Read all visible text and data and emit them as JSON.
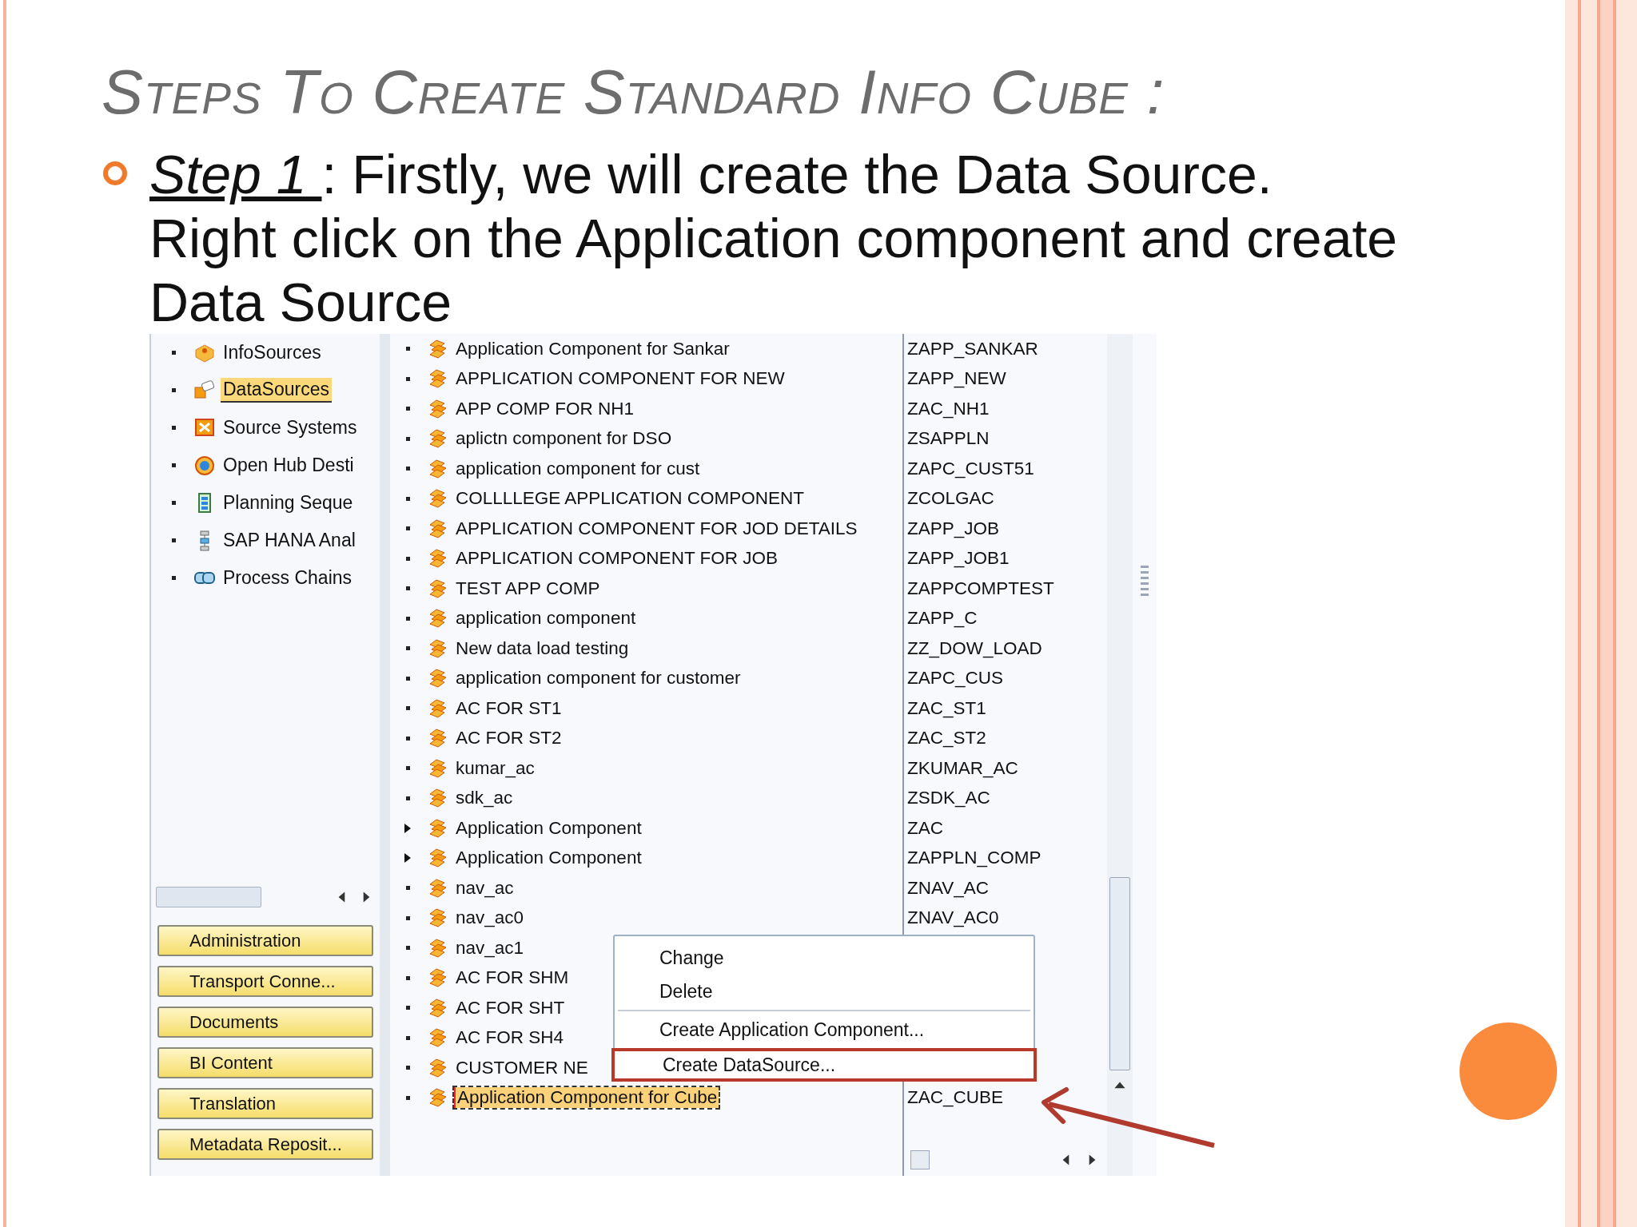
{
  "slide": {
    "title": "Steps To Create Standard Info Cube :",
    "step_label": "Step 1 ",
    "step_text": ": Firstly, we will create the Data Source. Right click on the Application component and create Data Source"
  },
  "sap": {
    "nav_tree": [
      {
        "label": "InfoSources",
        "selected": false
      },
      {
        "label": "DataSources",
        "selected": true
      },
      {
        "label": "Source Systems",
        "selected": false
      },
      {
        "label": "Open Hub Desti",
        "selected": false
      },
      {
        "label": "Planning Seque",
        "selected": false
      },
      {
        "label": "SAP HANA Anal",
        "selected": false
      },
      {
        "label": "Process Chains",
        "selected": false
      }
    ],
    "nav_buttons": [
      "Administration",
      "Transport Conne...",
      "Documents",
      "BI Content",
      "Translation",
      "Metadata Reposit..."
    ],
    "components": [
      {
        "name": "Application Component for Sankar",
        "tech_name": "ZAPP_SANKAR",
        "has_children": false,
        "selected": false
      },
      {
        "name": "APPLICATION COMPONENT FOR NEW",
        "tech_name": "ZAPP_NEW",
        "has_children": false,
        "selected": false
      },
      {
        "name": "APP COMP FOR NH1",
        "tech_name": "ZAC_NH1",
        "has_children": false,
        "selected": false
      },
      {
        "name": "aplictn component for DSO",
        "tech_name": "ZSAPPLN",
        "has_children": false,
        "selected": false
      },
      {
        "name": "application component for cust",
        "tech_name": "ZAPC_CUST51",
        "has_children": false,
        "selected": false
      },
      {
        "name": "COLLLLEGE APPLICATION COMPONENT",
        "tech_name": "ZCOLGAC",
        "has_children": false,
        "selected": false
      },
      {
        "name": "APPLICATION COMPONENT FOR JOD DETAILS",
        "tech_name": "ZAPP_JOB",
        "has_children": false,
        "selected": false
      },
      {
        "name": "APPLICATION COMPONENT FOR JOB",
        "tech_name": "ZAPP_JOB1",
        "has_children": false,
        "selected": false
      },
      {
        "name": "TEST APP COMP",
        "tech_name": "ZAPPCOMPTEST",
        "has_children": false,
        "selected": false
      },
      {
        "name": "application component",
        "tech_name": "ZAPP_C",
        "has_children": false,
        "selected": false
      },
      {
        "name": "New data load testing",
        "tech_name": "ZZ_DOW_LOAD",
        "has_children": false,
        "selected": false
      },
      {
        "name": "application component for customer",
        "tech_name": "ZAPC_CUS",
        "has_children": false,
        "selected": false
      },
      {
        "name": "AC FOR ST1",
        "tech_name": "ZAC_ST1",
        "has_children": false,
        "selected": false
      },
      {
        "name": "AC FOR ST2",
        "tech_name": "ZAC_ST2",
        "has_children": false,
        "selected": false
      },
      {
        "name": "kumar_ac",
        "tech_name": "ZKUMAR_AC",
        "has_children": false,
        "selected": false
      },
      {
        "name": "sdk_ac",
        "tech_name": "ZSDK_AC",
        "has_children": false,
        "selected": false
      },
      {
        "name": "Application Component",
        "tech_name": "ZAC",
        "has_children": true,
        "selected": false
      },
      {
        "name": "Application Component",
        "tech_name": "ZAPPLN_COMP",
        "has_children": true,
        "selected": false
      },
      {
        "name": "nav_ac",
        "tech_name": "ZNAV_AC",
        "has_children": false,
        "selected": false
      },
      {
        "name": "nav_ac0",
        "tech_name": "ZNAV_AC0",
        "has_children": false,
        "selected": false
      },
      {
        "name": "nav_ac1",
        "has_children": false,
        "selected": false
      },
      {
        "name": "AC FOR SHM",
        "has_children": false,
        "selected": false
      },
      {
        "name": "AC FOR SHT",
        "has_children": false,
        "selected": false
      },
      {
        "name": "AC FOR SH4",
        "has_children": false,
        "selected": false
      },
      {
        "name": "CUSTOMER NE",
        "has_children": false,
        "selected": false
      },
      {
        "name": "Application Component for Cube",
        "tech_name": "ZAC_CUBE",
        "has_children": false,
        "selected": true
      }
    ],
    "context_menu": [
      {
        "kind": "item",
        "label": "Change",
        "highlighted": false
      },
      {
        "kind": "item",
        "label": "Delete",
        "highlighted": false
      },
      {
        "kind": "separator"
      },
      {
        "kind": "item",
        "label": "Create Application Component...",
        "highlighted": false
      },
      {
        "kind": "item",
        "label": "Create DataSource...",
        "highlighted": true
      }
    ]
  }
}
